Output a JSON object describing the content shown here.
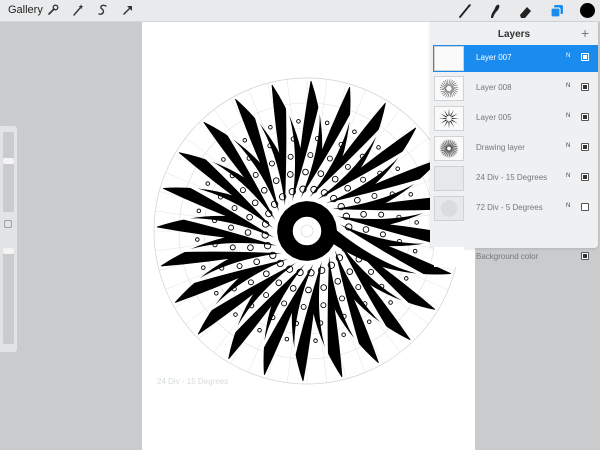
{
  "toolbar": {
    "gallery_label": "Gallery",
    "left_tools": [
      "wrench-icon",
      "magic-wand-icon",
      "selection-icon",
      "transform-arrow-icon"
    ],
    "right_tools": [
      "brush-icon",
      "smudge-icon",
      "eraser-icon",
      "layers-icon"
    ],
    "active_color": "#000000",
    "accent_color": "#1a8cf0"
  },
  "canvas": {
    "ghost_label": "24 Div - 15 Degrees"
  },
  "layers_panel": {
    "title": "Layers",
    "add_icon": "+",
    "layers": [
      {
        "name": "Layer 007",
        "mode": "N",
        "visible": true,
        "selected": true
      },
      {
        "name": "Layer 008",
        "mode": "N",
        "visible": true,
        "selected": false
      },
      {
        "name": "Layer 005",
        "mode": "N",
        "visible": true,
        "selected": false
      },
      {
        "name": "Drawing layer",
        "mode": "N",
        "visible": true,
        "selected": false
      },
      {
        "name": "24 Div - 15 Degrees",
        "mode": "N",
        "visible": true,
        "selected": false
      },
      {
        "name": "72 Div - 5 Degrees",
        "mode": "N",
        "visible": false,
        "selected": false
      }
    ],
    "background": {
      "name": "Background color",
      "visible": true
    }
  },
  "sidebar": {
    "brush_size_level": 0.65,
    "opacity_level": 1.0
  }
}
